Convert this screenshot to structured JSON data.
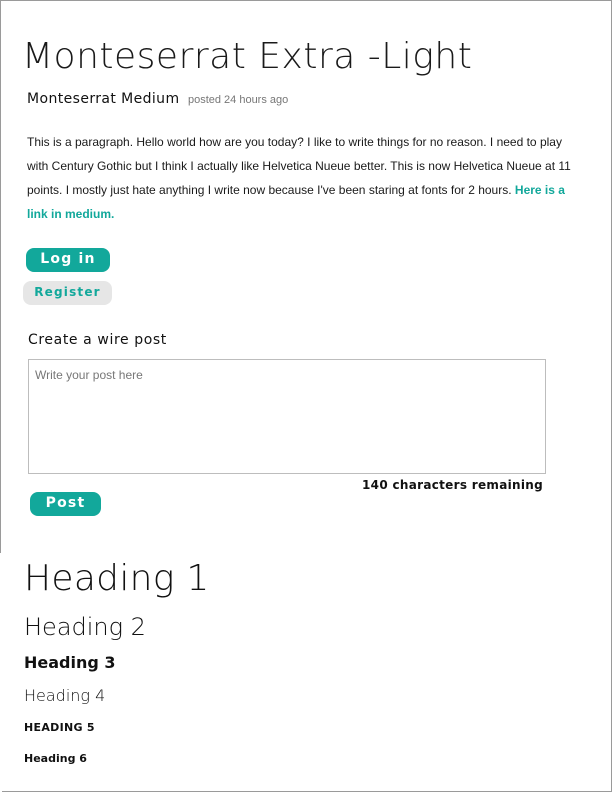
{
  "header": {
    "title": "Monteserrat Extra -Light",
    "author": "Monteserrat Medium",
    "posted": "posted 24 hours ago"
  },
  "body": {
    "paragraph": "This is a paragraph. Hello world how are you today? I like to write things for no reason. I need to play with Century Gothic but I think I actually like Helvetica Nueue better. This is now Helvetica Nueue at 11 points. I mostly just hate anything I write now because I've been staring at fonts for 2 hours.",
    "link_text": "Here is a link in medium."
  },
  "buttons": {
    "login": "Log in",
    "register": "Register",
    "post": "Post"
  },
  "wire": {
    "label": "Create a wire post",
    "placeholder": "Write your post here",
    "remaining": "140 characters remaining"
  },
  "headings": {
    "h1": "Heading 1",
    "h2": "Heading 2",
    "h3": "Heading 3",
    "h4": "Heading 4",
    "h5": "HEADING 5",
    "h6": "Heading 6"
  },
  "colors": {
    "accent": "#12a89b",
    "secondary_button": "#e6e6e6"
  }
}
